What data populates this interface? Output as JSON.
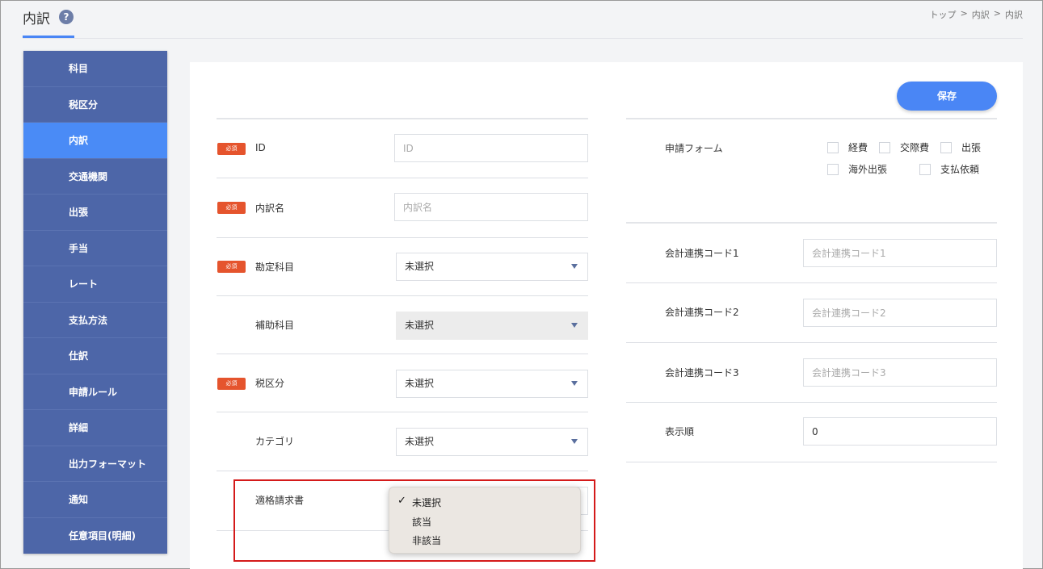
{
  "header": {
    "title": "内訳",
    "help": "?",
    "breadcrumb": [
      "トップ",
      ">",
      "内訳",
      ">",
      "内訳"
    ]
  },
  "sidebar": {
    "items": [
      {
        "label": "科目"
      },
      {
        "label": "税区分"
      },
      {
        "label": "内訳",
        "active": true
      },
      {
        "label": "交通機関"
      },
      {
        "label": "出張"
      },
      {
        "label": "手当"
      },
      {
        "label": "レート"
      },
      {
        "label": "支払方法"
      },
      {
        "label": "仕訳"
      },
      {
        "label": "申請ルール"
      },
      {
        "label": "詳細"
      },
      {
        "label": "出力フォーマット"
      },
      {
        "label": "通知"
      },
      {
        "label": "任意項目(明細)"
      }
    ]
  },
  "toolbar": {
    "save_label": "保存"
  },
  "required_badge": "必須",
  "form_left": {
    "id": {
      "label": "ID",
      "placeholder": "ID"
    },
    "name": {
      "label": "内訳名",
      "placeholder": "内訳名"
    },
    "account": {
      "label": "勘定科目",
      "value": "未選択"
    },
    "sub_account": {
      "label": "補助科目",
      "value": "未選択"
    },
    "tax": {
      "label": "税区分",
      "value": "未選択"
    },
    "category": {
      "label": "カテゴリ",
      "value": "未選択"
    },
    "invoice": {
      "label": "適格請求書"
    }
  },
  "form_right": {
    "apply_form": {
      "label": "申請フォーム",
      "options": [
        "経費",
        "交際費",
        "出張",
        "海外出張",
        "支払依頼"
      ]
    },
    "code1": {
      "label": "会計連携コード1",
      "placeholder": "会計連携コード1"
    },
    "code2": {
      "label": "会計連携コード2",
      "placeholder": "会計連携コード2"
    },
    "code3": {
      "label": "会計連携コード3",
      "placeholder": "会計連携コード3"
    },
    "order": {
      "label": "表示順",
      "value": "0"
    }
  },
  "invoice_dropdown": {
    "check": "✓",
    "options": [
      "未選択",
      "該当",
      "非該当"
    ],
    "selected": "未選択"
  },
  "colors": {
    "sidebar": "#4d66a8",
    "sidebar_active": "#4a8bf6",
    "primary": "#4a86f5",
    "required": "#e5542d",
    "highlight": "#d41a1a"
  }
}
